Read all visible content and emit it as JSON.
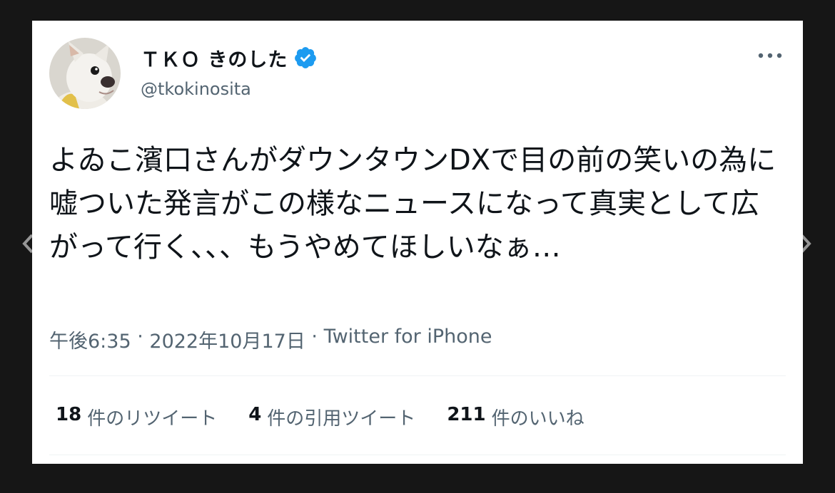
{
  "user": {
    "display_name": "ＴＫＯ きのした",
    "handle": "@tkokinosita",
    "verified": true
  },
  "tweet": {
    "text": "よゐこ濱口さんがダウンタウンDXで目の前の笑いの為に嘘ついた発言がこの様なニュースになって真実として広がって行く、、、もうやめてほしいなぁ…"
  },
  "meta": {
    "time": "午後6:35",
    "separator": " · ",
    "date": "2022年10月17日",
    "source": "Twitter for iPhone"
  },
  "stats": {
    "retweets_count": "18",
    "retweets_label": "件のリツイート",
    "quotes_count": "4",
    "quotes_label": "件の引用ツイート",
    "likes_count": "211",
    "likes_label": "件のいいね"
  },
  "colors": {
    "verified_badge": "#1d9bf0",
    "text_primary": "#0f1419",
    "text_secondary": "#536471"
  },
  "icons": {
    "verified": "verified-badge-icon",
    "more": "more-dots-icon",
    "prev": "chevron-left-icon",
    "next": "chevron-right-icon"
  }
}
